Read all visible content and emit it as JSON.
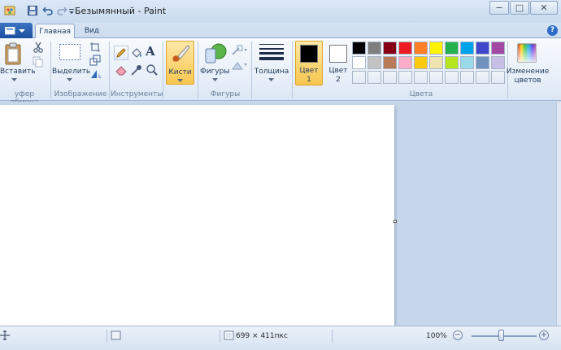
{
  "window": {
    "title": "Безымянный - Paint",
    "controls": {
      "minimize": "−",
      "maximize": "□",
      "close": "✕"
    }
  },
  "quick_access": {
    "icons": [
      "paint-app-icon",
      "save-icon",
      "undo-icon",
      "redo-icon",
      "customize-dropdown-icon"
    ]
  },
  "tabs": [
    {
      "label": "Главная",
      "active": true
    },
    {
      "label": "Вид",
      "active": false
    }
  ],
  "ribbon": {
    "clipboard": {
      "paste_label": "Вставить",
      "group_label": "уфер обмена"
    },
    "image": {
      "select_label": "Выделить",
      "group_label": "Изображение"
    },
    "tools": {
      "group_label": "Инструменты"
    },
    "brushes": {
      "label": "Кисти"
    },
    "shapes": {
      "label": "Фигуры",
      "group_label": "Фигуры"
    },
    "size": {
      "label": "Толщина"
    },
    "color1": {
      "label_line1": "Цвет",
      "label_line2": "1",
      "value": "#000000"
    },
    "color2": {
      "label_line1": "Цвет",
      "label_line2": "2",
      "value": "#ffffff"
    },
    "colors": {
      "group_label": "Цвета",
      "row1": [
        "#000000",
        "#7f7f7f",
        "#880015",
        "#ed1c24",
        "#ff7f27",
        "#fff200",
        "#22b14c",
        "#00a2e8",
        "#3f48cc",
        "#a349a4"
      ],
      "row2": [
        "#ffffff",
        "#c3c3c3",
        "#b97a57",
        "#ffaec9",
        "#ffc90e",
        "#efe4b0",
        "#b5e61d",
        "#99d9ea",
        "#7092be",
        "#c8bfe7"
      ]
    },
    "edit_colors": {
      "label_line1": "Изменение",
      "label_line2": "цветов"
    }
  },
  "status": {
    "canvas_size": "699 × 411пкс",
    "zoom": "100%",
    "zoom_out": "−",
    "zoom_in": "+",
    "zoom_level": 100
  },
  "accent": "#2a6cc6"
}
